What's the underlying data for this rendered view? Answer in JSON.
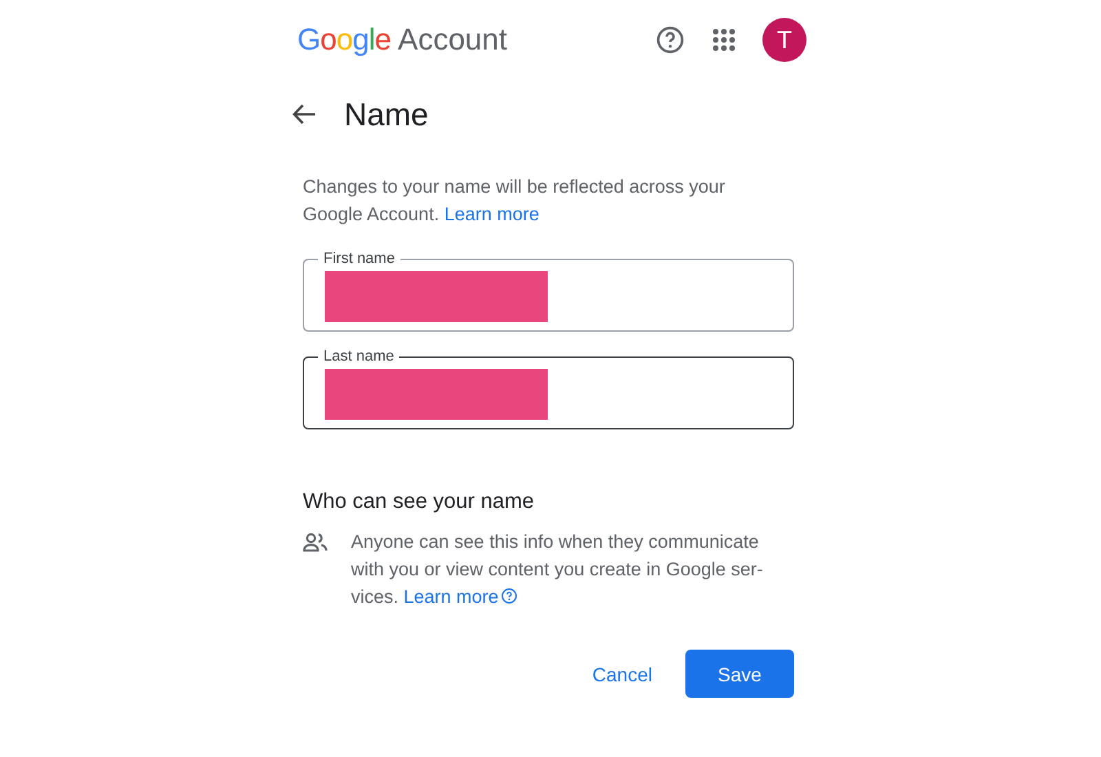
{
  "header": {
    "logo": "Google",
    "product": "Account",
    "avatar_letter": "T"
  },
  "page": {
    "title": "Name"
  },
  "intro": {
    "text": "Changes to your name will be reflected across your Google Account.",
    "link": "Learn more"
  },
  "fields": [
    {
      "label": "First name",
      "focused": false
    },
    {
      "label": "Last name",
      "focused": true
    }
  ],
  "visibility": {
    "heading": "Who can see your name",
    "text": "Anyone can see this info when they communicate with you or view content you create in Google ser-vices.",
    "link": "Learn more"
  },
  "buttons": {
    "cancel": "Cancel",
    "save": "Save"
  }
}
